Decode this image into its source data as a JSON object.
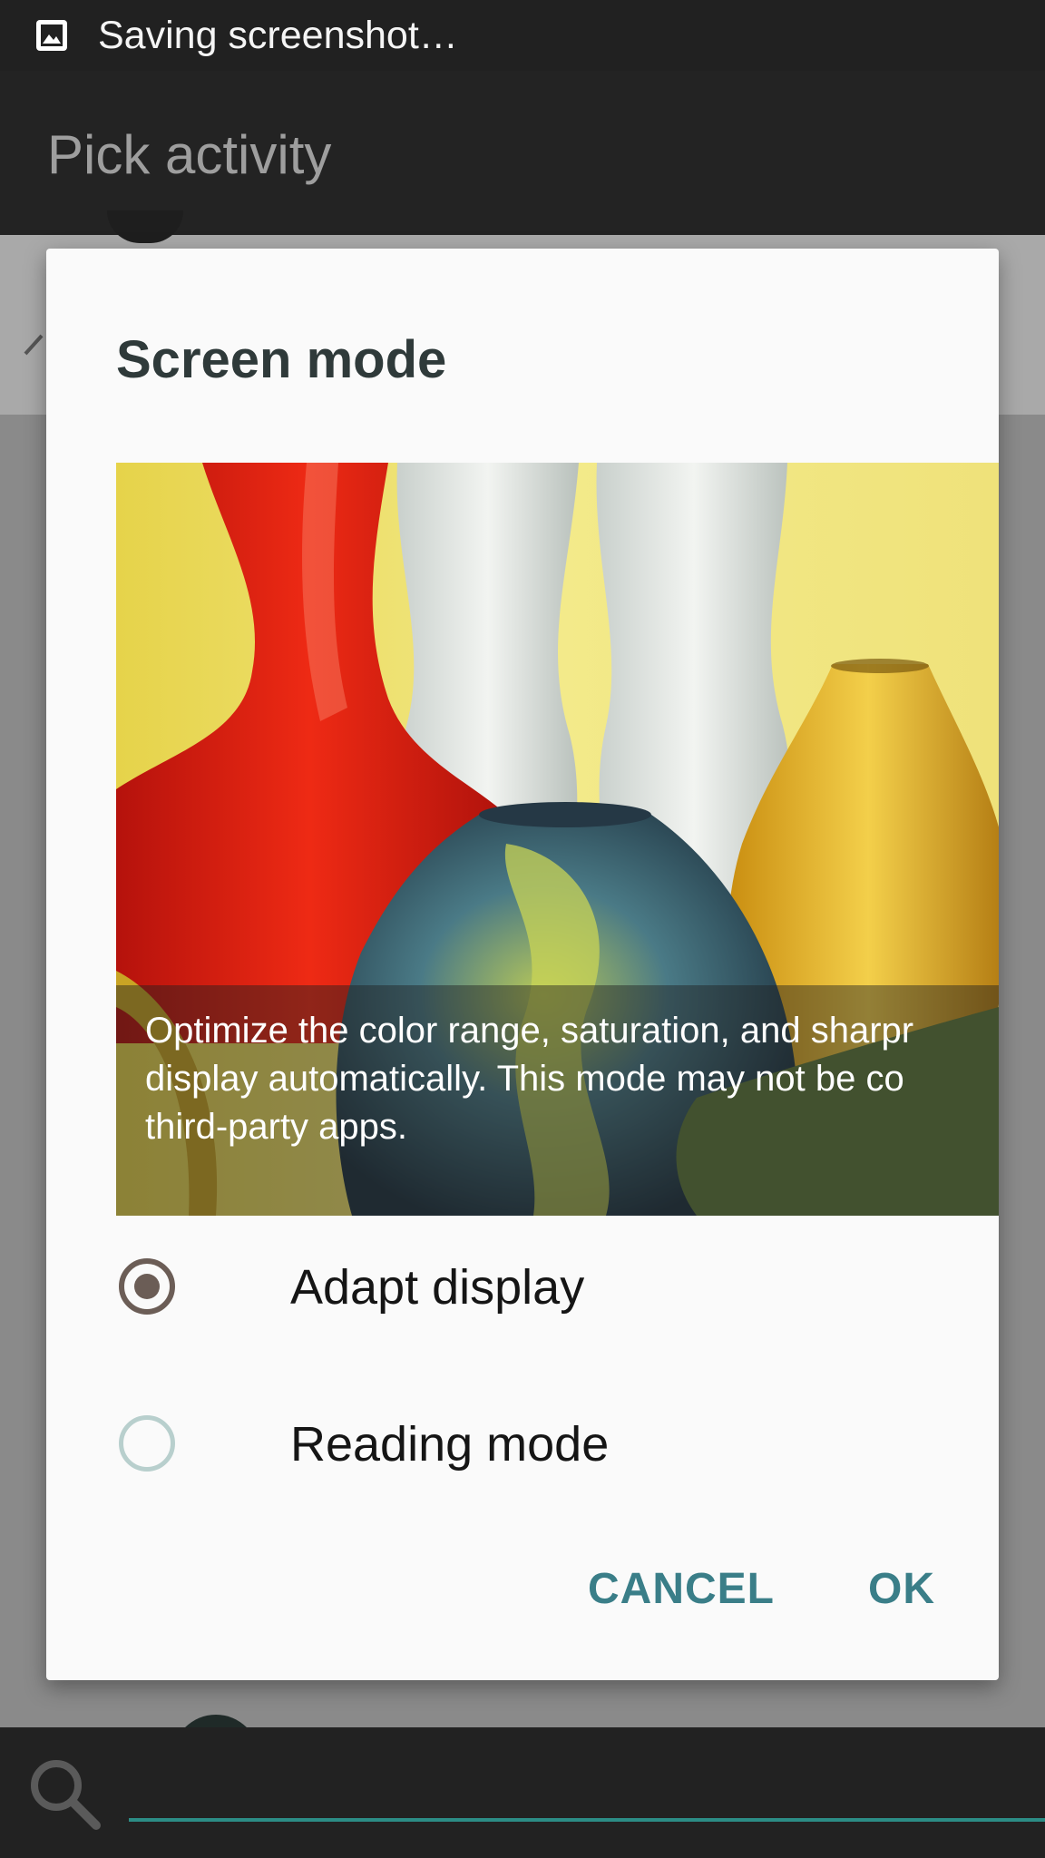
{
  "status_bar": {
    "notification_icon": "image-icon",
    "text": "Saving screenshot…"
  },
  "app_bar": {
    "title": "Pick activity"
  },
  "dialog": {
    "title": "Screen mode",
    "preview": {
      "caption": "Optimize the color range, saturation, and sharpr\ndisplay automatically. This mode may not be co\nthird-party apps."
    },
    "options": [
      {
        "label": "Adapt display",
        "checked": true
      },
      {
        "label": "Reading mode",
        "checked": false
      }
    ],
    "buttons": {
      "cancel": "CANCEL",
      "ok": "OK"
    }
  },
  "search": {
    "icon": "search-icon",
    "placeholder": ""
  },
  "colors": {
    "accent": "#3a7e88",
    "radio_checked": "#6b5d56",
    "search_underline": "#2c8d86"
  }
}
